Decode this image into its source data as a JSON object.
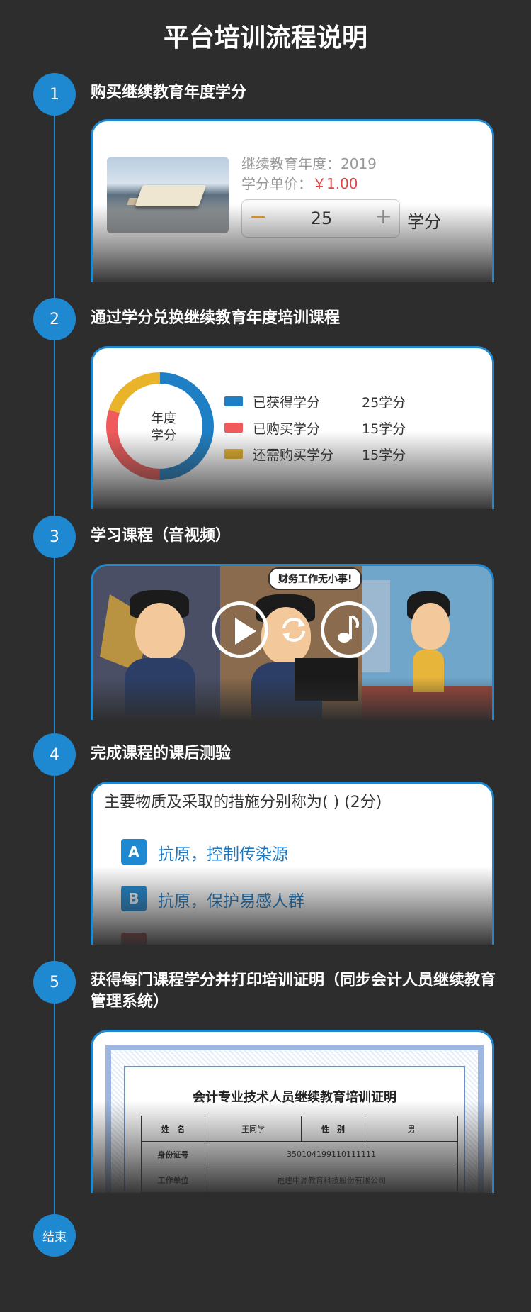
{
  "title": "平台培训流程说明",
  "steps": [
    {
      "num": "1",
      "title": "购买继续教育年度学分"
    },
    {
      "num": "2",
      "title": "通过学分兑换继续教育年度培训课程"
    },
    {
      "num": "3",
      "title": "学习课程（音视频）"
    },
    {
      "num": "4",
      "title": "完成课程的课后测验"
    },
    {
      "num": "5",
      "title": "获得每门课程学分并打印培训证明（同步会计人员继续教育管理系统）"
    }
  ],
  "purchase": {
    "year_label": "继续教育年度：2019",
    "price_label": "学分单价：",
    "price_value": "￥1.00",
    "minus": "−",
    "quantity": "25",
    "plus": "+",
    "unit": "学分"
  },
  "credits": {
    "center_line1": "年度",
    "center_line2": "学分",
    "legend": [
      {
        "name": "已获得学分",
        "value": "25学分",
        "color": "#1e7fc4"
      },
      {
        "name": "已购买学分",
        "value": "15学分",
        "color": "#f05a5a"
      },
      {
        "name": "还需购买学分",
        "value": "15学分",
        "color": "#e9b32a"
      }
    ],
    "arc_fractions": [
      0.5,
      0.3,
      0.2
    ],
    "arc_colors": [
      "#1e7fc4",
      "#f05a5a",
      "#e9b32a"
    ]
  },
  "video": {
    "bubble": "财务工作无小事!"
  },
  "quiz": {
    "question": "主要物质及采取的措施分别称为( ) (2分)",
    "options": [
      {
        "letter": "A",
        "text": "抗原，控制传染源"
      },
      {
        "letter": "B",
        "text": "抗原，保护易感人群"
      }
    ]
  },
  "certificate": {
    "title": "会计专业技术人员继续教育培训证明",
    "name_label": "姓　名",
    "name_value": "王同学",
    "gender_label": "性　别",
    "gender_value": "男",
    "id_label": "身份证号",
    "id_value": "350104199110111111",
    "unit_label": "工作单位",
    "unit_value": "福建中源教育科技股份有限公司"
  },
  "end_label": "结束"
}
